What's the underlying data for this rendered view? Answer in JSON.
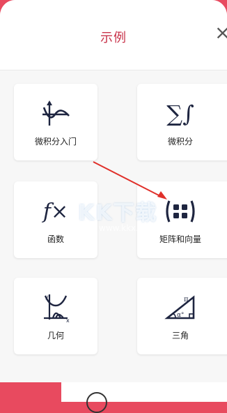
{
  "header": {
    "title": "示例"
  },
  "cards": [
    {
      "label": "微积分入门",
      "icon": "calculus-curve-icon"
    },
    {
      "label": "微积分",
      "icon": "sum-integral-icon"
    },
    {
      "label": "函数",
      "icon": "function-fx-icon"
    },
    {
      "label": "矩阵和向量",
      "icon": "matrix-icon"
    },
    {
      "label": "几何",
      "icon": "geometry-axes-icon"
    },
    {
      "label": "三角",
      "icon": "triangle-icon"
    }
  ],
  "icons": {
    "sum_integral_text": "∑∫",
    "fx_text": "f×",
    "triangle_pi": "π",
    "triangle_alpha": "α°"
  },
  "watermark": {
    "text": "KK下载",
    "url": "www.kkx.net"
  },
  "colors": {
    "accent": "#c8334a",
    "brand_bg": "#e84a5f",
    "icon": "#1e2540",
    "arrow": "#e0302a"
  }
}
